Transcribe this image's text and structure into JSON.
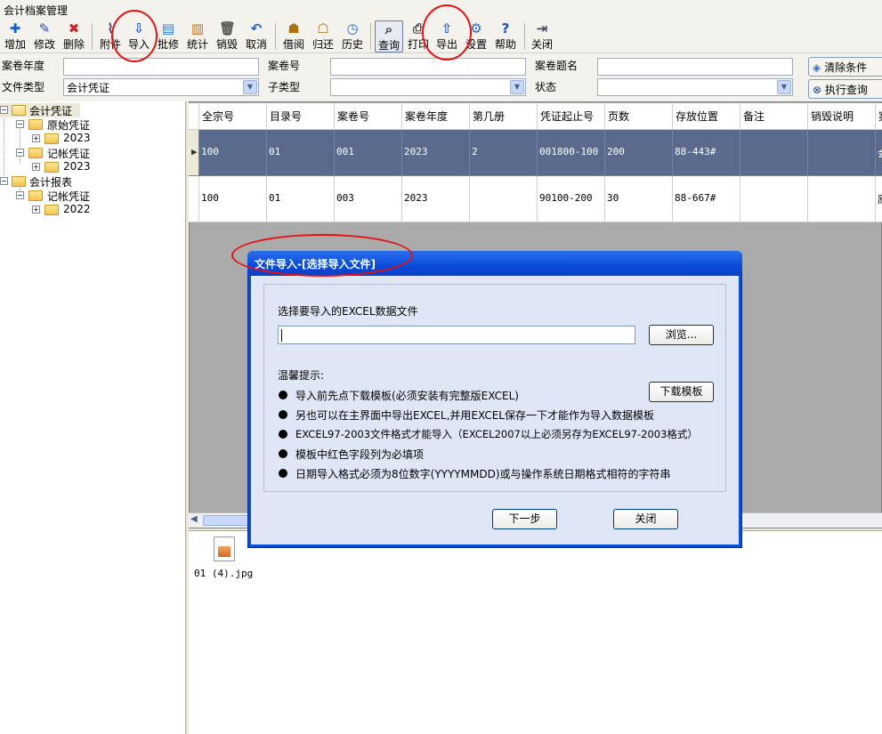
{
  "window": {
    "title": "会计档案管理"
  },
  "toolbar": [
    {
      "label": "增加",
      "icon": "add-icon",
      "glyph": "✚",
      "color": "#1a5fd0"
    },
    {
      "label": "修改",
      "icon": "pencil-icon",
      "glyph": "✎",
      "color": "#2a4fb0"
    },
    {
      "label": "删除",
      "icon": "delete-icon",
      "glyph": "✖",
      "color": "#d02020"
    },
    {
      "label": "附件",
      "icon": "paperclip-icon",
      "glyph": "⌇",
      "color": "#446"
    },
    {
      "label": "导入",
      "icon": "import-icon",
      "glyph": "⇩",
      "color": "#2a6ad0"
    },
    {
      "label": "批修",
      "icon": "batch-edit-icon",
      "glyph": "▤",
      "color": "#2a7ad0"
    },
    {
      "label": "统计",
      "icon": "statistics-icon",
      "glyph": "▥",
      "color": "#c07010"
    },
    {
      "label": "销毁",
      "icon": "trash-icon",
      "glyph": "🗑",
      "color": "#555"
    },
    {
      "label": "取消",
      "icon": "undo-icon",
      "glyph": "↶",
      "color": "#1a5fd0"
    },
    {
      "label": "借阅",
      "icon": "borrow-icon",
      "glyph": "☗",
      "color": "#b07010"
    },
    {
      "label": "归还",
      "icon": "return-icon",
      "glyph": "☖",
      "color": "#b07010"
    },
    {
      "label": "历史",
      "icon": "clock-icon",
      "glyph": "◷",
      "color": "#2a6ad0"
    },
    {
      "label": "查询",
      "icon": "search-icon",
      "glyph": "⌕",
      "color": "#333"
    },
    {
      "label": "打印",
      "icon": "print-icon",
      "glyph": "⎙",
      "color": "#444"
    },
    {
      "label": "导出",
      "icon": "export-icon",
      "glyph": "⇧",
      "color": "#2a6ad0"
    },
    {
      "label": "设置",
      "icon": "gear-icon",
      "glyph": "⚙",
      "color": "#2a6ad0"
    },
    {
      "label": "帮助",
      "icon": "help-icon",
      "glyph": "?",
      "color": "#1a4fc0"
    },
    {
      "label": "关闭",
      "icon": "exit-icon",
      "glyph": "⇥",
      "color": "#446"
    }
  ],
  "filters": {
    "year_label": "案卷年度",
    "volume_no_label": "案卷号",
    "volume_title_label": "案卷题名",
    "file_type_label": "文件类型",
    "file_type_value": "会计凭证",
    "subtype_label": "子类型",
    "status_label": "状态",
    "clear_button": "清除条件",
    "execute_button": "执行查询"
  },
  "tree": {
    "root1": "会计凭证",
    "child1": "原始凭证",
    "child1_year": "2023",
    "child2": "记帐凭证",
    "child2_year": "2023",
    "root2": "会计报表",
    "child3": "记帐凭证",
    "child3_year": "2022"
  },
  "grid": {
    "columns": [
      "全宗号",
      "目录号",
      "案卷号",
      "案卷年度",
      "第几册",
      "凭证起止号",
      "页数",
      "存放位置",
      "备注",
      "销毁说明",
      "案"
    ],
    "rows": [
      [
        "100",
        "01",
        "001",
        "2023",
        "2",
        "001800-100",
        "200",
        "88-443#",
        "",
        "",
        "会"
      ],
      [
        "100",
        "01",
        "003",
        "2023",
        "",
        "90100-200",
        "30",
        "88-667#",
        "",
        "",
        "原"
      ]
    ]
  },
  "attachment": {
    "filename": "01 (4).jpg"
  },
  "dialog": {
    "title": "文件导入-[选择导入文件]",
    "prompt": "选择要导入的EXCEL数据文件",
    "path_value": "",
    "browse_button": "浏览...",
    "tips_title": "温馨提示:",
    "download_button": "下载模板",
    "tips": [
      "导入前先点下载模板(必须安装有完整版EXCEL)",
      "另也可以在主界面中导出EXCEL,并用EXCEL保存一下才能作为导入数据模板",
      "EXCEL97-2003文件格式才能导入（EXCEL2007以上必须另存为EXCEL97-2003格式）",
      "模板中红色字段列为必填项",
      "日期导入格式必须为8位数字(YYYYMMDD)或与操作系统日期格式相符的字符串"
    ],
    "next_button": "下一步",
    "close_button": "关闭"
  },
  "colors": {
    "selected_row": "#5a6a8c",
    "dialog_title": "#0a4ad8",
    "annotation_oval": "#e81010"
  }
}
